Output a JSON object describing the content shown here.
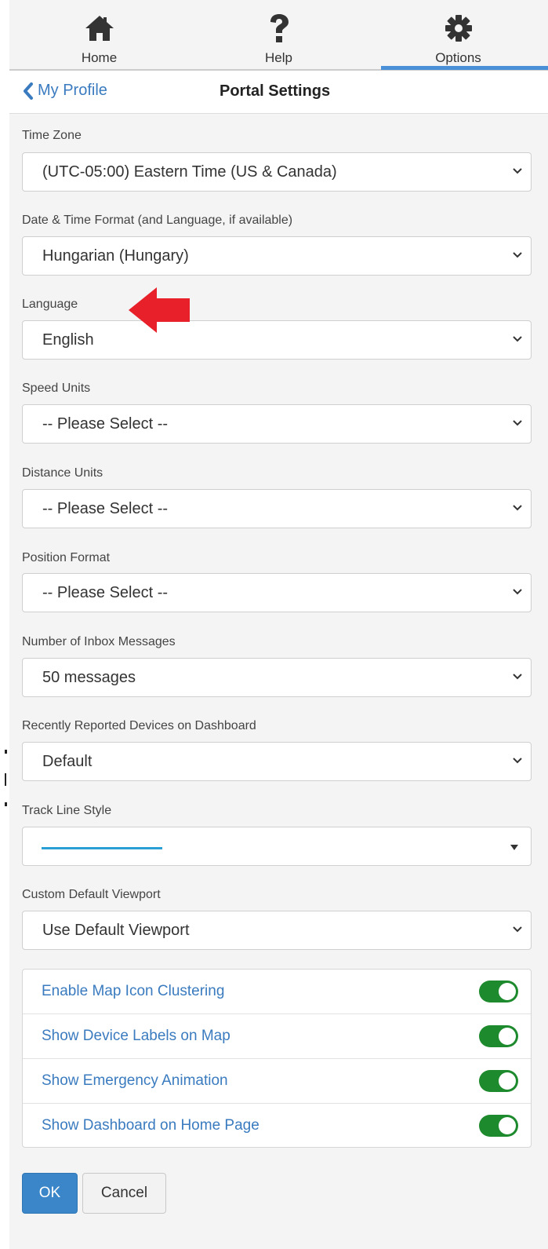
{
  "nav": {
    "items": [
      {
        "label": "Home",
        "icon": "home-icon"
      },
      {
        "label": "Help",
        "icon": "help-icon"
      },
      {
        "label": "Options",
        "icon": "gear-icon",
        "active": true
      }
    ]
  },
  "header": {
    "back_label": "My Profile",
    "title": "Portal Settings"
  },
  "fields": {
    "time_zone": {
      "label": "Time Zone",
      "value": "(UTC-05:00) Eastern Time (US & Canada)"
    },
    "date_format": {
      "label": "Date & Time Format (and Language, if available)",
      "value": "Hungarian (Hungary)"
    },
    "language": {
      "label": "Language",
      "value": "English"
    },
    "speed_units": {
      "label": "Speed Units",
      "value": "-- Please Select --"
    },
    "distance_units": {
      "label": "Distance Units",
      "value": "-- Please Select --"
    },
    "position_format": {
      "label": "Position Format",
      "value": "-- Please Select --"
    },
    "inbox_messages": {
      "label": "Number of Inbox Messages",
      "value": "50 messages"
    },
    "recent_devices": {
      "label": "Recently Reported Devices on Dashboard",
      "value": "Default"
    },
    "track_line_style": {
      "label": "Track Line Style",
      "line_color": "#2a9fd6"
    },
    "default_viewport": {
      "label": "Custom Default Viewport",
      "value": "Use Default Viewport"
    }
  },
  "toggles": [
    {
      "label": "Enable Map Icon Clustering",
      "on": true
    },
    {
      "label": "Show Device Labels on Map",
      "on": true
    },
    {
      "label": "Show Emergency Animation",
      "on": true
    },
    {
      "label": "Show Dashboard on Home Page",
      "on": true
    }
  ],
  "buttons": {
    "ok": "OK",
    "cancel": "Cancel"
  },
  "colors": {
    "accent": "#3a7bbf",
    "primary_button": "#3a86c8",
    "toggle_on": "#1e8a2e",
    "annotation_arrow": "#e8202a"
  }
}
